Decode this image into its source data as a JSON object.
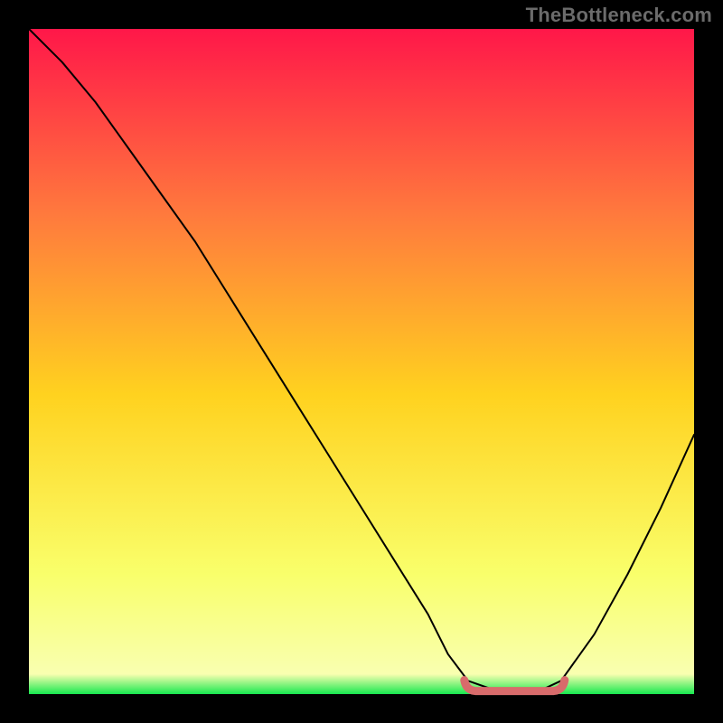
{
  "watermark": "TheBottleneck.com",
  "colors": {
    "black": "#000000",
    "curve": "#000000",
    "highlight": "#d86b6b",
    "grad_top": "#ff1749",
    "grad_mid_upper": "#ff7a3d",
    "grad_mid": "#ffd21f",
    "grad_lower": "#f9ff6b",
    "grad_green": "#17e84f"
  },
  "chart_data": {
    "type": "line",
    "title": "",
    "xlabel": "",
    "ylabel": "",
    "xlim": [
      0,
      100
    ],
    "ylim": [
      0,
      100
    ],
    "grid": false,
    "description": "Bottleneck-style curve: high mismatch far from optimum, dipping to a near-zero minimum across a flat optimal region, then rising again.",
    "series": [
      {
        "name": "bottleneck-curve",
        "x": [
          0,
          5,
          10,
          15,
          20,
          25,
          30,
          35,
          40,
          45,
          50,
          55,
          60,
          63,
          66,
          70,
          74,
          77,
          80,
          85,
          90,
          95,
          100
        ],
        "values": [
          100,
          95,
          89,
          82,
          75,
          68,
          60,
          52,
          44,
          36,
          28,
          20,
          12,
          6,
          2,
          0.6,
          0.5,
          0.6,
          2,
          9,
          18,
          28,
          39
        ]
      }
    ],
    "highlight_region": {
      "name": "optimal-flat",
      "x_start": 66,
      "x_end": 80,
      "y": 0.6
    }
  }
}
